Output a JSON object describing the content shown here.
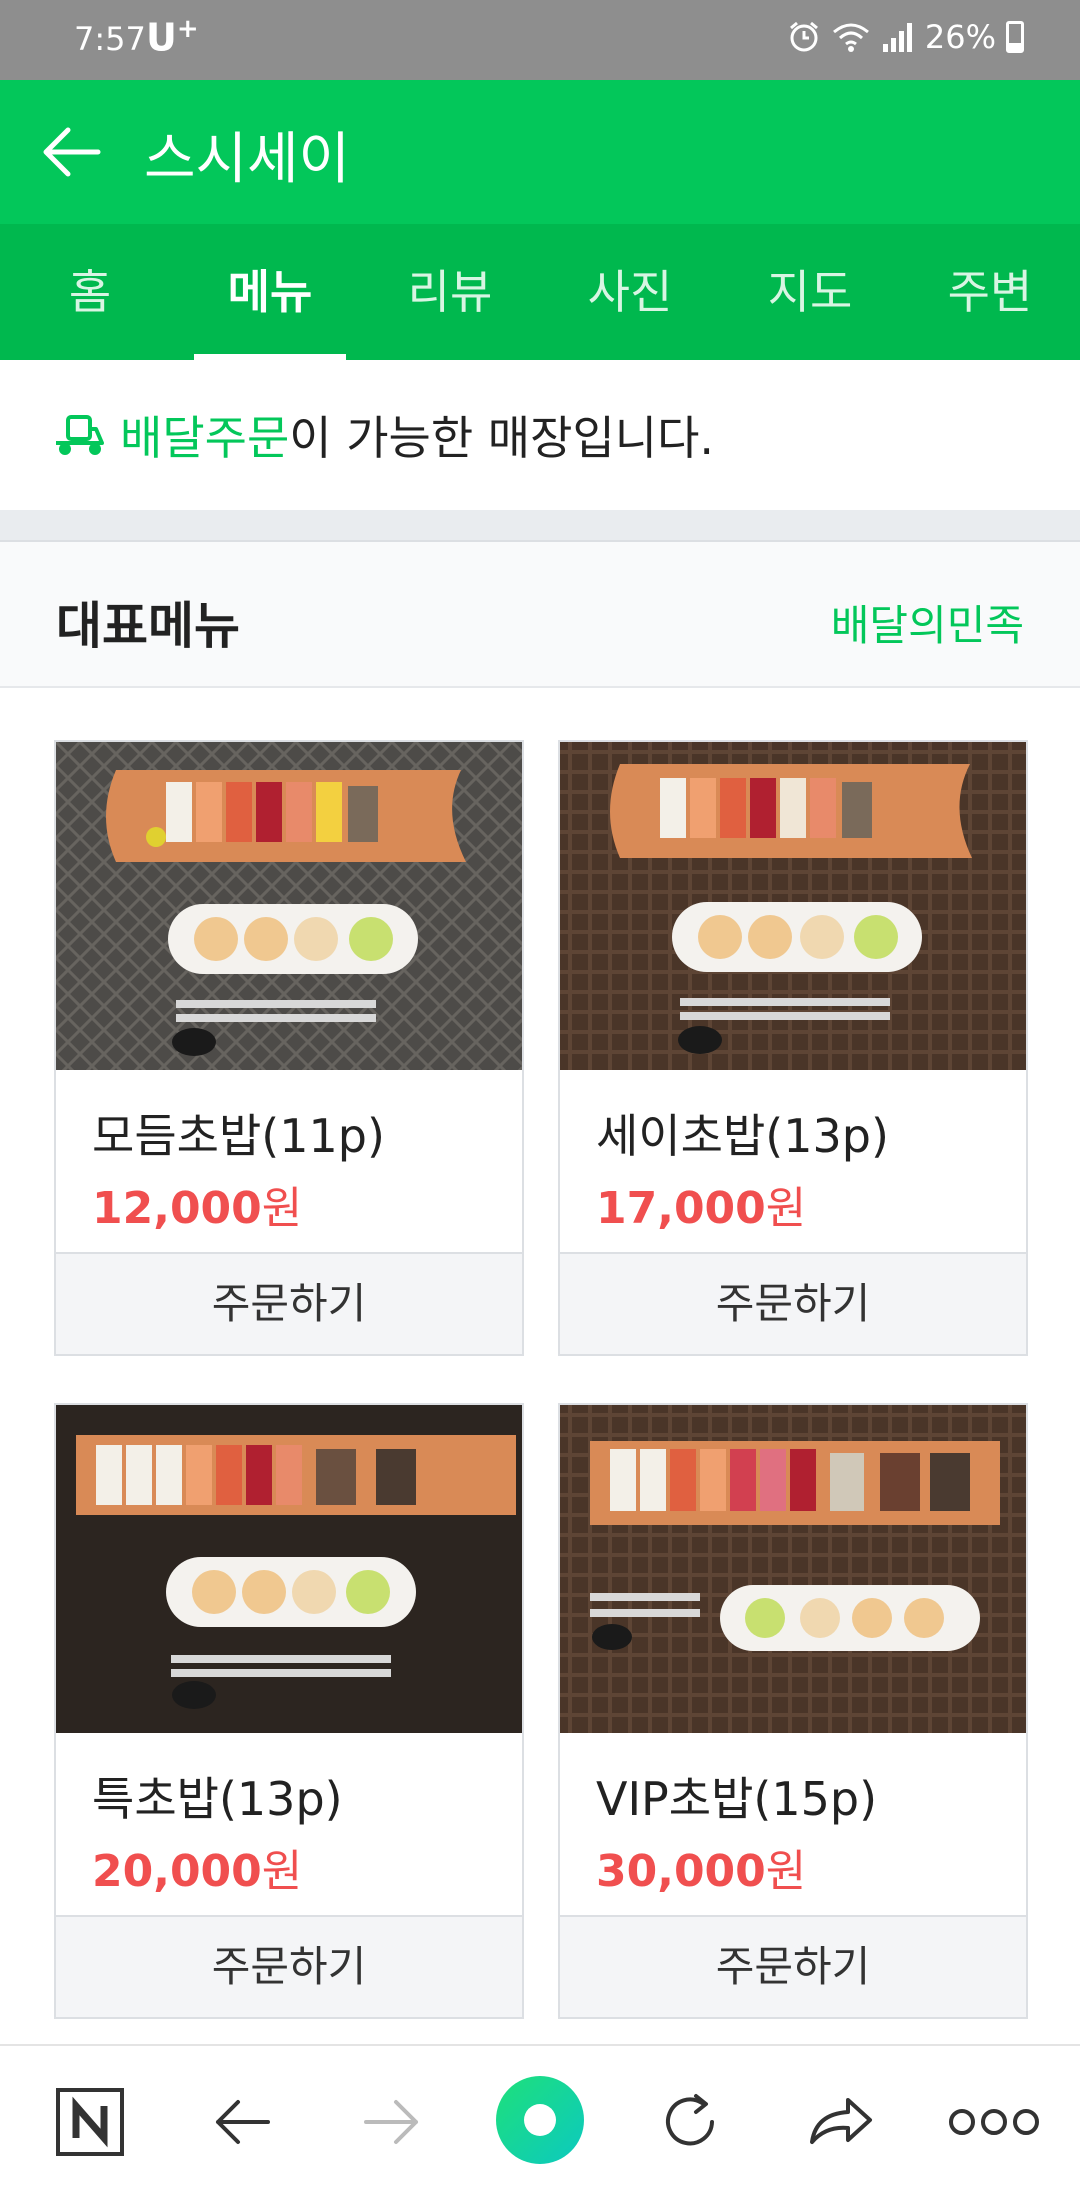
{
  "status": {
    "time": "7:57",
    "carrier": "U",
    "carrier_sup": "+",
    "battery": "26%"
  },
  "header": {
    "title": "스시세이",
    "back_icon": "arrow-left-icon"
  },
  "tabs": [
    {
      "label": "홈"
    },
    {
      "label": "메뉴",
      "active": true
    },
    {
      "label": "리뷰"
    },
    {
      "label": "사진"
    },
    {
      "label": "지도"
    },
    {
      "label": "주변"
    }
  ],
  "notice": {
    "highlight": "배달주문",
    "rest": "이 가능한 매장입니다.",
    "icon": "delivery-scooter-icon"
  },
  "section": {
    "title": "대표메뉴",
    "source_link": "배달의민족"
  },
  "menu_items": [
    {
      "name": "모듬초밥(11p)",
      "price_num": "12,000",
      "price_unit": "원",
      "order_label": "주문하기"
    },
    {
      "name": "세이초밥(13p)",
      "price_num": "17,000",
      "price_unit": "원",
      "order_label": "주문하기"
    },
    {
      "name": "특초밥(13p)",
      "price_num": "20,000",
      "price_unit": "원",
      "order_label": "주문하기"
    },
    {
      "name": "VIP초밥(15p)",
      "price_num": "30,000",
      "price_unit": "원",
      "order_label": "주문하기"
    }
  ],
  "bottom_nav": [
    "naver-home-icon",
    "back-arrow-icon",
    "forward-arrow-icon",
    "green-dot-icon",
    "refresh-icon",
    "share-icon",
    "more-icon"
  ],
  "colors": {
    "brand_green": "#03c75a",
    "tab_green": "#00b84e",
    "price_red": "#f04f4f"
  }
}
